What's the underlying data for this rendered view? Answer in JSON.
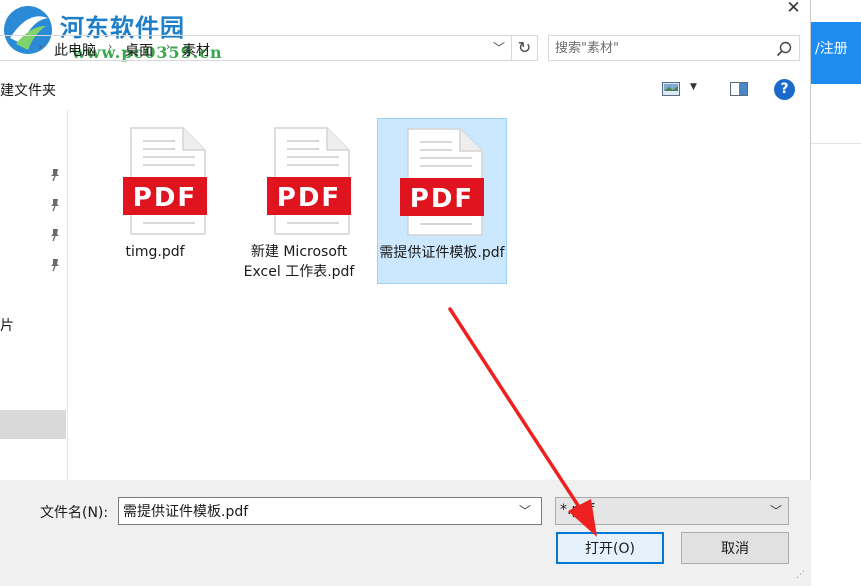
{
  "watermark": {
    "title": "河东软件园",
    "url": "www.pc0359.cn"
  },
  "window": {
    "close": "✕"
  },
  "address": {
    "crumbs": [
      "此电脑",
      "桌面",
      "素材"
    ],
    "separator": "›",
    "dropdown": "﹀",
    "refresh": "↻"
  },
  "search": {
    "placeholder": "搜索\"素材\""
  },
  "toolbar": {
    "new_folder": "建文件夹",
    "dropdown": "▼",
    "help": "?"
  },
  "nav": {
    "pictures_label": "片"
  },
  "files": [
    {
      "name": "timg.pdf",
      "icon_text": "PDF",
      "selected": false
    },
    {
      "name": "新建 Microsoft Excel 工作表.pdf",
      "icon_text": "PDF",
      "selected": false
    },
    {
      "name": "需提供证件模板.pdf",
      "icon_text": "PDF",
      "selected": true
    }
  ],
  "bottom": {
    "filename_label": "文件名(N):",
    "filename_value": "需提供证件模板.pdf",
    "filetype_value": "*.pdf",
    "dropdown": "﹀",
    "open_label": "打开(O)",
    "cancel_label": "取消",
    "grip": "⋰"
  },
  "background_app": {
    "register_label": "/注册"
  },
  "colors": {
    "accent": "#0078d7",
    "pdf_red": "#e0141e",
    "selection": "#cce8ff",
    "register_blue": "#1e8cf0"
  }
}
